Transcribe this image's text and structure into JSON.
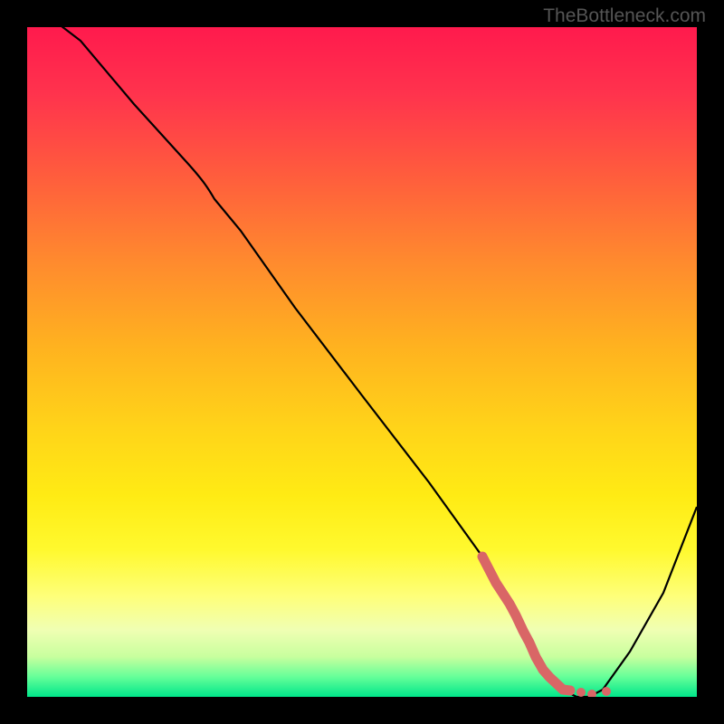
{
  "watermark": "TheBottleneck.com",
  "chart_data": {
    "type": "line",
    "title": "",
    "xlabel": "",
    "ylabel": "",
    "xlim": [
      0,
      100
    ],
    "ylim": [
      0,
      100
    ],
    "series": [
      {
        "name": "curve",
        "x": [
          0,
          8,
          16,
          24,
          26,
          28,
          32,
          40,
          50,
          60,
          68,
          72,
          74,
          76,
          78,
          80,
          82,
          84,
          86,
          90,
          95,
          100
        ],
        "y": [
          110,
          100,
          90,
          80,
          77,
          74,
          69,
          58,
          45,
          32,
          21,
          14,
          10,
          6,
          3,
          1,
          0,
          0,
          1,
          6,
          15,
          28
        ],
        "color": "#000000"
      },
      {
        "name": "highlight-segment",
        "x": [
          68,
          70,
          72,
          73,
          74,
          75,
          76,
          77,
          78,
          80,
          82
        ],
        "y": [
          21,
          17,
          14,
          12,
          10,
          8,
          6,
          4,
          3,
          1,
          1
        ],
        "color": "#d96666"
      },
      {
        "name": "highlight-dots",
        "type": "scatter",
        "x": [
          82,
          84,
          86
        ],
        "y": [
          1,
          0.5,
          0.8
        ],
        "color": "#d96666"
      }
    ],
    "gradient": {
      "top_color": "#ff1a4d",
      "bottom_color": "#00e68a"
    }
  }
}
